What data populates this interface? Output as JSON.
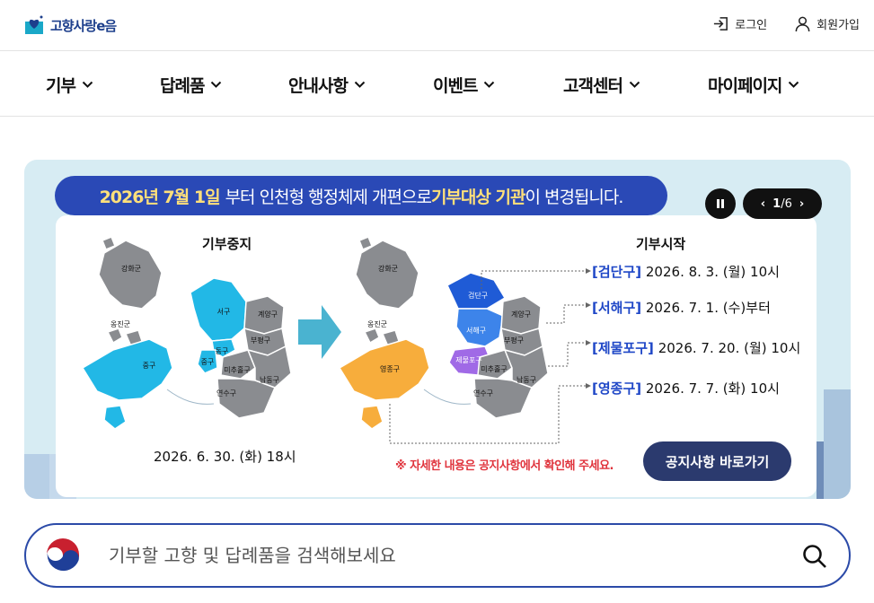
{
  "header": {
    "logo_text": "고향사랑e음",
    "login_label": "로그인",
    "signup_label": "회원가입"
  },
  "nav": {
    "items": [
      {
        "label": "기부"
      },
      {
        "label": "답례품"
      },
      {
        "label": "안내사항"
      },
      {
        "label": "이벤트"
      },
      {
        "label": "고객센터"
      },
      {
        "label": "마이페이지"
      }
    ]
  },
  "banner": {
    "headline_year": "2026년 7월 1일",
    "headline_mid": "부터 인천형 행정체제 개편으로 ",
    "headline_bold": "기부대상 기관",
    "headline_end": "이 변경됩니다.",
    "pager": {
      "current": "1",
      "total": "/6"
    },
    "left_title": "기부중지",
    "right_title": "기부시작",
    "left_date": "2026. 6. 30. (화) 18시",
    "left_map_labels": {
      "ganghwa": "강화군",
      "ongjin": "옹진군",
      "seo": "서구",
      "gyeyang": "계양구",
      "dong": "동구",
      "bupyeong": "부평구",
      "jung_small": "중구",
      "jung": "중구",
      "michuhol": "미추홀구",
      "namdong": "남동구",
      "yeonsu": "연수구"
    },
    "right_map_labels": {
      "ganghwa": "강화군",
      "ongjin": "옹진군",
      "geomdan": "검단구",
      "gyeyang": "계양구",
      "seohae": "서해구",
      "bupyeong": "부평구",
      "yeongjong": "영종구",
      "jemulpo": "제물포구",
      "michuhol": "미추홀구",
      "namdong": "남동구",
      "yeonsu": "연수구"
    },
    "schedule": [
      {
        "gu": "[검단구]",
        "date": " 2026. 8.  3. (월) 10시"
      },
      {
        "gu": "[서해구]",
        "date": " 2026. 7.  1. (수)부터"
      },
      {
        "gu": "[제물포구]",
        "date": " 2026. 7. 20. (월) 10시"
      },
      {
        "gu": "[영종구]",
        "date": " 2026. 7.  7. (화) 10시"
      }
    ],
    "notice": "※ 자세한 내용은 공지사항에서 확인해 주세요.",
    "notice_button": "공지사항 바로가기"
  },
  "search": {
    "placeholder": "기부할 고향 및 답례품을 검색해보세요"
  },
  "colors": {
    "brand": "#2a49b6",
    "highlight": "#ffe07a",
    "map_gray": "#8a8c90",
    "map_cyan": "#22b8e6",
    "map_blue": "#1f5bd6",
    "map_orange": "#f7ad3c",
    "map_purple": "#a06ae6",
    "notice_red": "#e0343d"
  }
}
